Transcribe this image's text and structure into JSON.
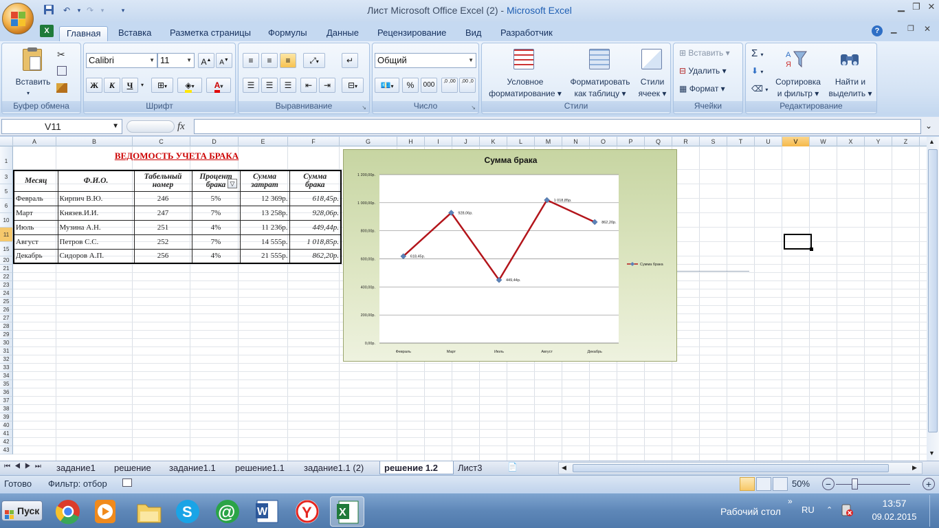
{
  "window": {
    "title": "Лист Microsoft Office Excel (2)",
    "separator": " - ",
    "app_name": "Microsoft Excel"
  },
  "ribbon_tabs": [
    "Главная",
    "Вставка",
    "Разметка страницы",
    "Формулы",
    "Данные",
    "Рецензирование",
    "Вид",
    "Разработчик"
  ],
  "ribbon": {
    "clipboard": {
      "label": "Буфер обмена",
      "paste": "Вставить"
    },
    "font": {
      "label": "Шрифт",
      "family": "Calibri",
      "size": "11",
      "bold": "Ж",
      "italic": "К",
      "underline": "Ч",
      "grow": "A",
      "shrink": "A",
      "font_color": "A"
    },
    "alignment": {
      "label": "Выравнивание"
    },
    "number": {
      "label": "Число",
      "format": "Общий",
      "percent": "%",
      "thousands": "000",
      "inc_decimal": ",0 ,00",
      "dec_decimal": ",00 ,0"
    },
    "styles": {
      "label": "Стили",
      "conditional": "Условное",
      "conditional2": "форматирование",
      "table": "Форматировать",
      "table2": "как таблицу",
      "cell": "Стили",
      "cell2": "ячеек"
    },
    "cells": {
      "label": "Ячейки",
      "insert": "Вставить",
      "delete": "Удалить",
      "format": "Формат"
    },
    "editing": {
      "label": "Редактирование",
      "sort": "Сортировка",
      "sort2": "и фильтр",
      "find": "Найти и",
      "find2": "выделить"
    }
  },
  "formula_bar": {
    "name_box": "V11",
    "fx": "fx",
    "value": ""
  },
  "columns": [
    "A",
    "B",
    "C",
    "D",
    "E",
    "F",
    "G",
    "H",
    "I",
    "J",
    "K",
    "L",
    "M",
    "N",
    "O",
    "P",
    "Q",
    "R",
    "S",
    "T",
    "U",
    "V",
    "W",
    "X",
    "Y",
    "Z"
  ],
  "selected_column": "V",
  "rows": [
    "1",
    "3",
    "5",
    "6",
    "10",
    "11",
    "15",
    "20",
    "21",
    "22",
    "23",
    "24",
    "25",
    "26",
    "27",
    "28",
    "29",
    "30",
    "31",
    "32",
    "33",
    "34",
    "35",
    "36",
    "37",
    "38",
    "39",
    "40",
    "41",
    "42",
    "43"
  ],
  "selected_row": "11",
  "sheet": {
    "title": "ВЕДОМОСТЬ УЧЕТА БРАКА",
    "headers": [
      "Месяц",
      "Ф.И.О.",
      "Табельный номер",
      "Процент брака",
      "Сумма затрат",
      "Сумма брака"
    ],
    "header_lines": [
      [
        "Месяц"
      ],
      [
        "Ф.И.О."
      ],
      [
        "Табельный",
        "номер"
      ],
      [
        "Процент",
        "брака"
      ],
      [
        "Сумма",
        "затрат"
      ],
      [
        "Сумма",
        "брака"
      ]
    ],
    "rows": [
      [
        "Февраль",
        "Кирпич В.Ю.",
        "246",
        "5%",
        "12 369р.",
        "618,45р."
      ],
      [
        "Март",
        "Князев.И.И.",
        "247",
        "7%",
        "13 258р.",
        "928,06р."
      ],
      [
        "Июль",
        "Музина А.Н.",
        "251",
        "4%",
        "11 236р.",
        "449,44р."
      ],
      [
        "Август",
        "Петров С.С.",
        "252",
        "7%",
        "14 555р.",
        "1 018,85р."
      ],
      [
        "Декабрь",
        "Сидоров А.П.",
        "256",
        "4%",
        "21 555р.",
        "862,20р."
      ]
    ]
  },
  "chart_data": {
    "type": "line",
    "title": "Сумма брака",
    "categories": [
      "Февраль",
      "Март",
      "Июль",
      "Август",
      "Декабрь"
    ],
    "series": [
      {
        "name": "Сумма брака",
        "values": [
          618.45,
          928.06,
          449.44,
          1018.85,
          862.2
        ],
        "labels": [
          "618,45р.",
          "928,06р.",
          "449,44р.",
          "1 018,85р.",
          "862,20р."
        ],
        "color": "#b3151b",
        "marker_color": "#5b82b8"
      }
    ],
    "y_ticks": [
      "0,00р.",
      "200,00р.",
      "400,00р.",
      "600,00р.",
      "800,00р.",
      "1 000,00р.",
      "1 200,00р."
    ],
    "ylim": [
      0,
      1200
    ],
    "grid": true,
    "legend": "right"
  },
  "sheet_tabs": [
    "задание1",
    "решение",
    "задание1.1",
    "решение1.1",
    "задание1.1 (2)",
    "решение 1.2",
    "Лист3"
  ],
  "active_sheet": "решение 1.2",
  "status": {
    "ready": "Готово",
    "filter": "Фильтр: отбор",
    "zoom": "50%"
  },
  "taskbar": {
    "start": "Пуск",
    "desktop": "Рабочий стол",
    "lang": "RU",
    "time": "13:57",
    "date": "09.02.2015"
  },
  "colors": {
    "accent": "#1f5fb3",
    "title_red": "#cc0000",
    "series": "#b3151b"
  }
}
